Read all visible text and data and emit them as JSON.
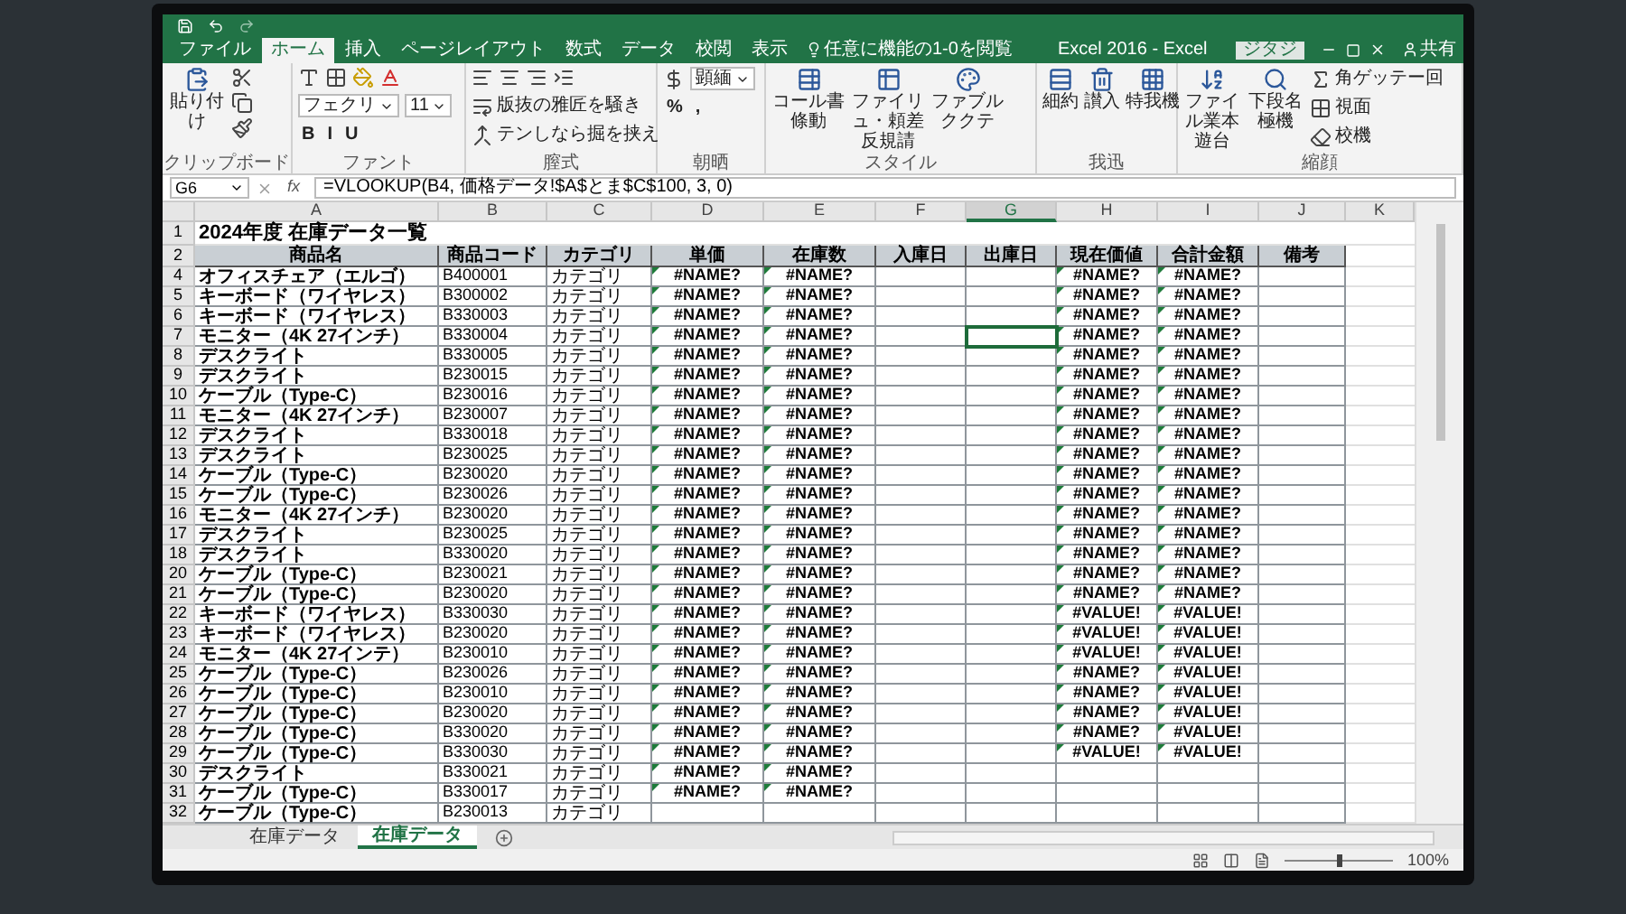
{
  "window": {
    "title": "Excel 2016 - Excel",
    "sign_in": "ジタジ",
    "share": "共有"
  },
  "ribbon_tabs": [
    {
      "label": "ファイル",
      "selected": false
    },
    {
      "label": "ホーム",
      "selected": true
    },
    {
      "label": "挿入",
      "selected": false
    },
    {
      "label": "ページレイアウト",
      "selected": false
    },
    {
      "label": "数式",
      "selected": false
    },
    {
      "label": "データ",
      "selected": false
    },
    {
      "label": "校閲",
      "selected": false
    },
    {
      "label": "表示",
      "selected": false
    }
  ],
  "tell_me": "任意に機能の1-0を閲覧",
  "ribbon_groups": [
    {
      "label": "クリップボード",
      "items": [
        {
          "kind": "large",
          "text": "貼り付け"
        }
      ]
    },
    {
      "label": "ファント",
      "items": [
        {
          "kind": "field",
          "text": "フェクリ"
        },
        {
          "kind": "field",
          "text": "11"
        },
        {
          "kind": "char",
          "text": "B"
        },
        {
          "kind": "char",
          "text": "I"
        },
        {
          "kind": "char",
          "text": "U"
        }
      ]
    },
    {
      "label": "膣式",
      "items": [
        {
          "kind": "small",
          "text": "版抜の雅匠を騒き"
        },
        {
          "kind": "small",
          "text": "テンしなら掘を挟え"
        }
      ]
    },
    {
      "label": "朝晒",
      "items": [
        {
          "kind": "field",
          "text": "顕緬"
        },
        {
          "kind": "char",
          "text": "%"
        },
        {
          "kind": "char",
          "text": ","
        }
      ]
    },
    {
      "label": "スタイル",
      "items": [
        {
          "kind": "large",
          "text": "コール書條動"
        },
        {
          "kind": "large",
          "text": "ファイリュ・頼差反規請"
        },
        {
          "kind": "large",
          "text": "ファブルククテ"
        }
      ]
    },
    {
      "label": "我迅",
      "items": [
        {
          "kind": "large",
          "text": "細約"
        },
        {
          "kind": "large",
          "text": "讃入"
        },
        {
          "kind": "large",
          "text": "特我機"
        }
      ]
    },
    {
      "label": "縮顔",
      "items": [
        {
          "kind": "small",
          "text": "角ゲッテー回"
        },
        {
          "kind": "small",
          "text": "視面"
        },
        {
          "kind": "small",
          "text": "校機"
        },
        {
          "kind": "large",
          "text": "ファイル業本遊台"
        },
        {
          "kind": "large",
          "text": "下段名極機"
        }
      ]
    }
  ],
  "formula_bar": {
    "name_box": "G6",
    "fx": "fx",
    "formula": "=VLOOKUP(B4, 価格データ!$A$とま$C$100, 3, 0)"
  },
  "columns": [
    {
      "label": "A",
      "selected": false
    },
    {
      "label": "B",
      "selected": false
    },
    {
      "label": "C",
      "selected": false
    },
    {
      "label": "D",
      "selected": false
    },
    {
      "label": "E",
      "selected": false
    },
    {
      "label": "F",
      "selected": false
    },
    {
      "label": "G",
      "selected": true
    },
    {
      "label": "H",
      "selected": false
    },
    {
      "label": "I",
      "selected": false
    },
    {
      "label": "J",
      "selected": false
    },
    {
      "label": "K",
      "selected": false
    }
  ],
  "sheet_title": {
    "row": "1",
    "text": "2024年度 在庫データ一覧"
  },
  "header_row": {
    "row": "2",
    "labels": [
      "商品名",
      "商品コード",
      "カテゴリ",
      "単価",
      "在庫数",
      "入庫日",
      "出庫日",
      "現在価値",
      "合計金額",
      "備考"
    ]
  },
  "rows": [
    {
      "row": "4",
      "name": "オフィスチェア（エルゴ）",
      "code": "B400001",
      "category": "カテゴリ",
      "price": "#NAME?",
      "stock": "#NAME?",
      "value": "#NAME?",
      "total": "#NAME?",
      "g_selected": false
    },
    {
      "row": "5",
      "name": "キーボード（ワイヤレス）",
      "code": "B300002",
      "category": "カテゴリ",
      "price": "#NAME?",
      "stock": "#NAME?",
      "value": "#NAME?",
      "total": "#NAME?",
      "g_selected": false
    },
    {
      "row": "6",
      "name": "キーボード（ワイヤレス）",
      "code": "B330003",
      "category": "カテゴリ",
      "price": "#NAME?",
      "stock": "#NAME?",
      "value": "#NAME?",
      "total": "#NAME?",
      "g_selected": false
    },
    {
      "row": "7",
      "name": "モニター（4K 27インチ）",
      "code": "B330004",
      "category": "カテゴリ",
      "price": "#NAME?",
      "stock": "#NAME?",
      "value": "#NAME?",
      "total": "#NAME?",
      "g_selected": true
    },
    {
      "row": "8",
      "name": "デスクライト",
      "code": "B330005",
      "category": "カテゴリ",
      "price": "#NAME?",
      "stock": "#NAME?",
      "value": "#NAME?",
      "total": "#NAME?",
      "g_selected": false
    },
    {
      "row": "9",
      "name": "デスクライト",
      "code": "B230015",
      "category": "カテゴリ",
      "price": "#NAME?",
      "stock": "#NAME?",
      "value": "#NAME?",
      "total": "#NAME?",
      "g_selected": false
    },
    {
      "row": "10",
      "name": "ケーブル（Type-C）",
      "code": "B230016",
      "category": "カテゴリ",
      "price": "#NAME?",
      "stock": "#NAME?",
      "value": "#NAME?",
      "total": "#NAME?",
      "g_selected": false
    },
    {
      "row": "11",
      "name": "モニター（4K 27インチ）",
      "code": "B230007",
      "category": "カテゴリ",
      "price": "#NAME?",
      "stock": "#NAME?",
      "value": "#NAME?",
      "total": "#NAME?",
      "g_selected": false
    },
    {
      "row": "12",
      "name": "デスクライト",
      "code": "B330018",
      "category": "カテゴリ",
      "price": "#NAME?",
      "stock": "#NAME?",
      "value": "#NAME?",
      "total": "#NAME?",
      "g_selected": false
    },
    {
      "row": "13",
      "name": "デスクライト",
      "code": "B230025",
      "category": "カテゴリ",
      "price": "#NAME?",
      "stock": "#NAME?",
      "value": "#NAME?",
      "total": "#NAME?",
      "g_selected": false
    },
    {
      "row": "14",
      "name": "ケーブル（Type-C）",
      "code": "B230020",
      "category": "カテゴリ",
      "price": "#NAME?",
      "stock": "#NAME?",
      "value": "#NAME?",
      "total": "#NAME?",
      "g_selected": false
    },
    {
      "row": "15",
      "name": "ケーブル（Type-C）",
      "code": "B230026",
      "category": "カテゴリ",
      "price": "#NAME?",
      "stock": "#NAME?",
      "value": "#NAME?",
      "total": "#NAME?",
      "g_selected": false
    },
    {
      "row": "16",
      "name": "モニター（4K 27インチ）",
      "code": "B230020",
      "category": "カテゴリ",
      "price": "#NAME?",
      "stock": "#NAME?",
      "value": "#NAME?",
      "total": "#NAME?",
      "g_selected": false
    },
    {
      "row": "17",
      "name": "デスクライト",
      "code": "B230025",
      "category": "カテゴリ",
      "price": "#NAME?",
      "stock": "#NAME?",
      "value": "#NAME?",
      "total": "#NAME?",
      "g_selected": false
    },
    {
      "row": "18",
      "name": "デスクライト",
      "code": "B330020",
      "category": "カテゴリ",
      "price": "#NAME?",
      "stock": "#NAME?",
      "value": "#NAME?",
      "total": "#NAME?",
      "g_selected": false
    },
    {
      "row": "20",
      "name": "ケーブル（Type-C）",
      "code": "B230021",
      "category": "カテゴリ",
      "price": "#NAME?",
      "stock": "#NAME?",
      "value": "#NAME?",
      "total": "#NAME?",
      "g_selected": false
    },
    {
      "row": "21",
      "name": "ケーブル（Type-C）",
      "code": "B230020",
      "category": "カテゴリ",
      "price": "#NAME?",
      "stock": "#NAME?",
      "value": "#NAME?",
      "total": "#NAME?",
      "g_selected": false
    },
    {
      "row": "22",
      "name": "キーボード（ワイヤレス）",
      "code": "B330030",
      "category": "カテゴリ",
      "price": "#NAME?",
      "stock": "#NAME?",
      "value": "#VALUE!",
      "total": "#VALUE!",
      "g_selected": false
    },
    {
      "row": "23",
      "name": "キーボード（ワイヤレス）",
      "code": "B230020",
      "category": "カテゴリ",
      "price": "#NAME?",
      "stock": "#NAME?",
      "value": "#VALUE!",
      "total": "#VALUE!",
      "g_selected": false
    },
    {
      "row": "24",
      "name": "モニター（4K 27インテ）",
      "code": "B230010",
      "category": "カテゴリ",
      "price": "#NAME?",
      "stock": "#NAME?",
      "value": "#VALUE!",
      "total": "#VALUE!",
      "g_selected": false
    },
    {
      "row": "25",
      "name": "ケーブル（Type-C）",
      "code": "B230026",
      "category": "カテゴリ",
      "price": "#NAME?",
      "stock": "#NAME?",
      "value": "#NAME?",
      "total": "#VALUE!",
      "g_selected": false
    },
    {
      "row": "26",
      "name": "ケーブル（Type-C）",
      "code": "B230010",
      "category": "カテゴリ",
      "price": "#NAME?",
      "stock": "#NAME?",
      "value": "#NAME?",
      "total": "#VALUE!",
      "g_selected": false
    },
    {
      "row": "27",
      "name": "ケーブル（Type-C）",
      "code": "B230020",
      "category": "カテゴリ",
      "price": "#NAME?",
      "stock": "#NAME?",
      "value": "#NAME?",
      "total": "#VALUE!",
      "g_selected": false
    },
    {
      "row": "28",
      "name": "ケーブル（Type-C）",
      "code": "B330020",
      "category": "カテゴリ",
      "price": "#NAME?",
      "stock": "#NAME?",
      "value": "#NAME?",
      "total": "#VALUE!",
      "g_selected": false
    },
    {
      "row": "29",
      "name": "ケーブル（Type-C）",
      "code": "B330030",
      "category": "カテゴリ",
      "price": "#NAME?",
      "stock": "#NAME?",
      "value": "#VALUE!",
      "total": "#VALUE!",
      "g_selected": false
    },
    {
      "row": "30",
      "name": "デスクライト",
      "code": "B330021",
      "category": "カテゴリ",
      "price": "#NAME?",
      "stock": "#NAME?",
      "g_selected": false
    },
    {
      "row": "31",
      "name": "ケーブル（Type-C）",
      "code": "B330017",
      "category": "カテゴリ",
      "price": "#NAME?",
      "stock": "#NAME?",
      "g_selected": false
    },
    {
      "row": "32",
      "name": "ケーブル（Type-C）",
      "code": "B230013",
      "category": "カテゴリ",
      "g_selected": false
    }
  ],
  "sheet_tabs": [
    {
      "label": "在庫データ",
      "selected": false
    },
    {
      "label": "在庫データ",
      "selected": true
    }
  ],
  "status_bar": {
    "zoom": "100%",
    "zoom_slider": {
      "level": 0.5
    }
  }
}
